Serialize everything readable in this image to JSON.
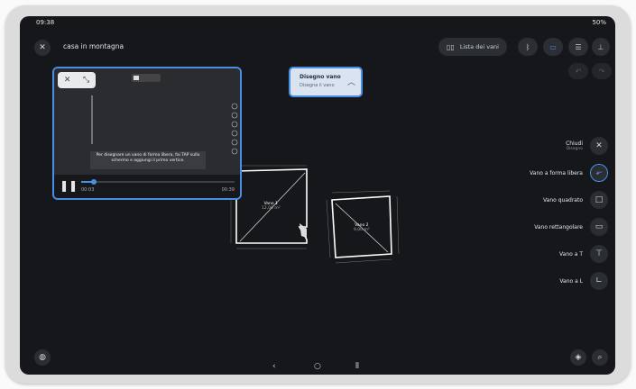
{
  "status": {
    "time": "09:38",
    "battery": "50%"
  },
  "header": {
    "title": "casa in montagna",
    "room_list": "Lista dei vani"
  },
  "popup": {
    "title": "Disegno vano",
    "subtitle": "Disegna il vano"
  },
  "video": {
    "caption": "Per disegnare un vano di forma libera, fai TAP sullo schermo e aggiungi il primo vertice.",
    "time_current": "00:03",
    "time_total": "00:39",
    "progress": 0.08
  },
  "menu": {
    "close": {
      "label": "Chiudi",
      "sub": "Disegno"
    },
    "items": [
      {
        "label": "Vano a forma libera",
        "icon": "free-shape-icon"
      },
      {
        "label": "Vano quadrato",
        "icon": "square-icon"
      },
      {
        "label": "Vano rettangolare",
        "icon": "rectangle-icon"
      },
      {
        "label": "Vano a T",
        "icon": "t-shape-icon"
      },
      {
        "label": "Vano a L",
        "icon": "l-shape-icon"
      }
    ]
  },
  "plan": {
    "rooms": [
      {
        "name": "Vano 1",
        "sub": "12,00 m²"
      },
      {
        "name": "Vano 2",
        "sub": "9,00 m²"
      }
    ]
  },
  "colors": {
    "accent": "#4a90e2",
    "background": "#15171b"
  }
}
